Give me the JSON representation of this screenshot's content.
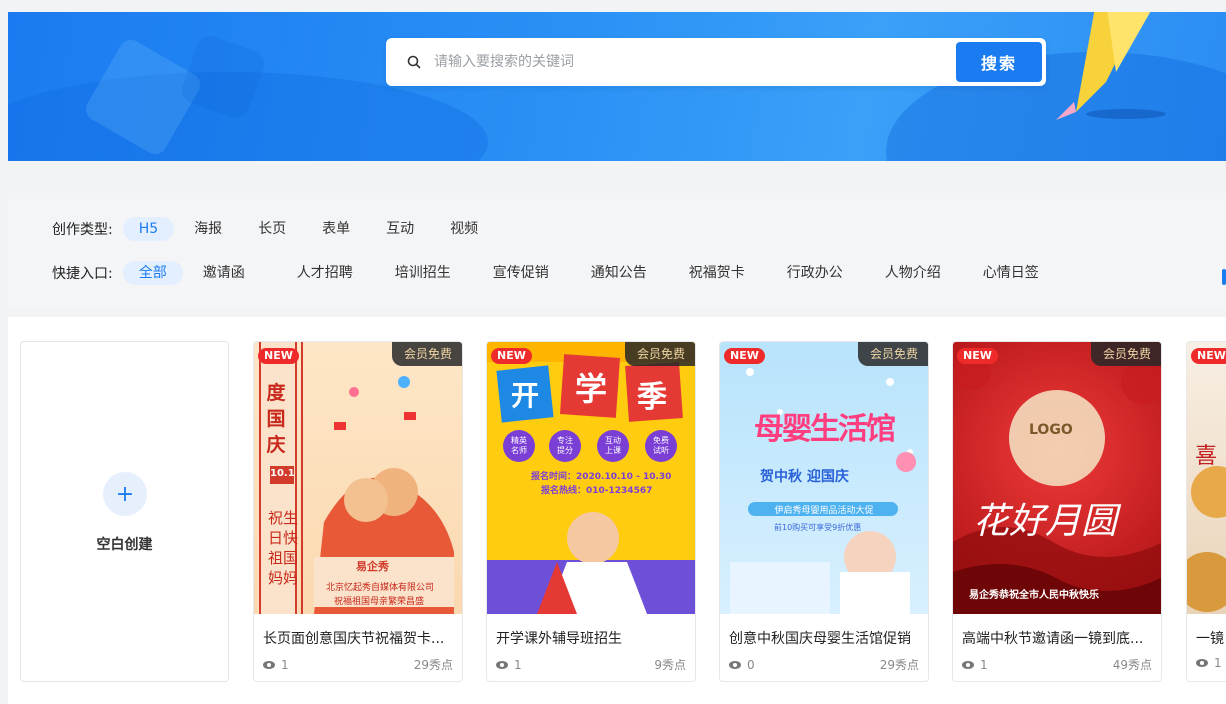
{
  "search": {
    "placeholder": "请输入要搜索的关键词",
    "button_label": "搜索"
  },
  "filters": {
    "type_label": "创作类型:",
    "types": [
      "H5",
      "海报",
      "长页",
      "表单",
      "互动",
      "视频"
    ],
    "active_type": "H5",
    "quick_label": "快捷入口:",
    "quick": [
      "全部",
      "邀请函",
      "人才招聘",
      "培训招生",
      "宣传促销",
      "通知公告",
      "祝福贺卡",
      "行政办公",
      "人物介绍",
      "心情日签"
    ],
    "active_quick": "全部"
  },
  "blank_card": {
    "plus": "+",
    "label": "空白创建"
  },
  "cards": [
    {
      "title": "长页面创意国庆节祝福贺卡...",
      "views": "1",
      "points": "29秀点",
      "new_label": "NEW",
      "free_label": "会员免费",
      "thumb_text": {
        "big": "度国庆",
        "date": "10.1",
        "poem": "祝生日快 祖国妈妈",
        "brand": "易企秀",
        "company": "北京忆起秀自媒体有限公司",
        "sub": "祝福祖国母亲繁荣昌盛"
      }
    },
    {
      "title": "开学课外辅导班招生",
      "views": "1",
      "points": "9秀点",
      "new_label": "NEW",
      "free_label": "会员免费",
      "thumb_text": {
        "c1": "开",
        "c2": "学",
        "c3": "季",
        "b1": "精英名师",
        "b2": "专注提分",
        "b3": "互动上课",
        "b4": "免费试听",
        "time": "报名时间：2020.10.10 - 10.30",
        "phone": "报名热线：010-1234567"
      }
    },
    {
      "title": "创意中秋国庆母婴生活馆促销",
      "views": "0",
      "points": "29秀点",
      "new_label": "NEW",
      "free_label": "会员免费",
      "thumb_text": {
        "big": "母婴生活馆",
        "sub": "贺中秋 迎国庆",
        "strip": "伊启秀母婴用品活动大促",
        "note": "前10购买可享受9折优惠"
      }
    },
    {
      "title": "高端中秋节邀请函一镜到底...",
      "views": "1",
      "points": "49秀点",
      "new_label": "NEW",
      "free_label": "会员免费",
      "thumb_text": {
        "logo": "LOGO",
        "big": "花好月圆",
        "bottom": "易企秀恭祝全市人民中秋快乐"
      }
    },
    {
      "title": "一镜",
      "views": "1",
      "points": "",
      "new_label": "NEW",
      "free_label": "",
      "thumb_text": {
        "big": "喜"
      }
    }
  ],
  "colors": {
    "accent": "#1a7cf0",
    "new_badge": "#ef2a2a"
  }
}
